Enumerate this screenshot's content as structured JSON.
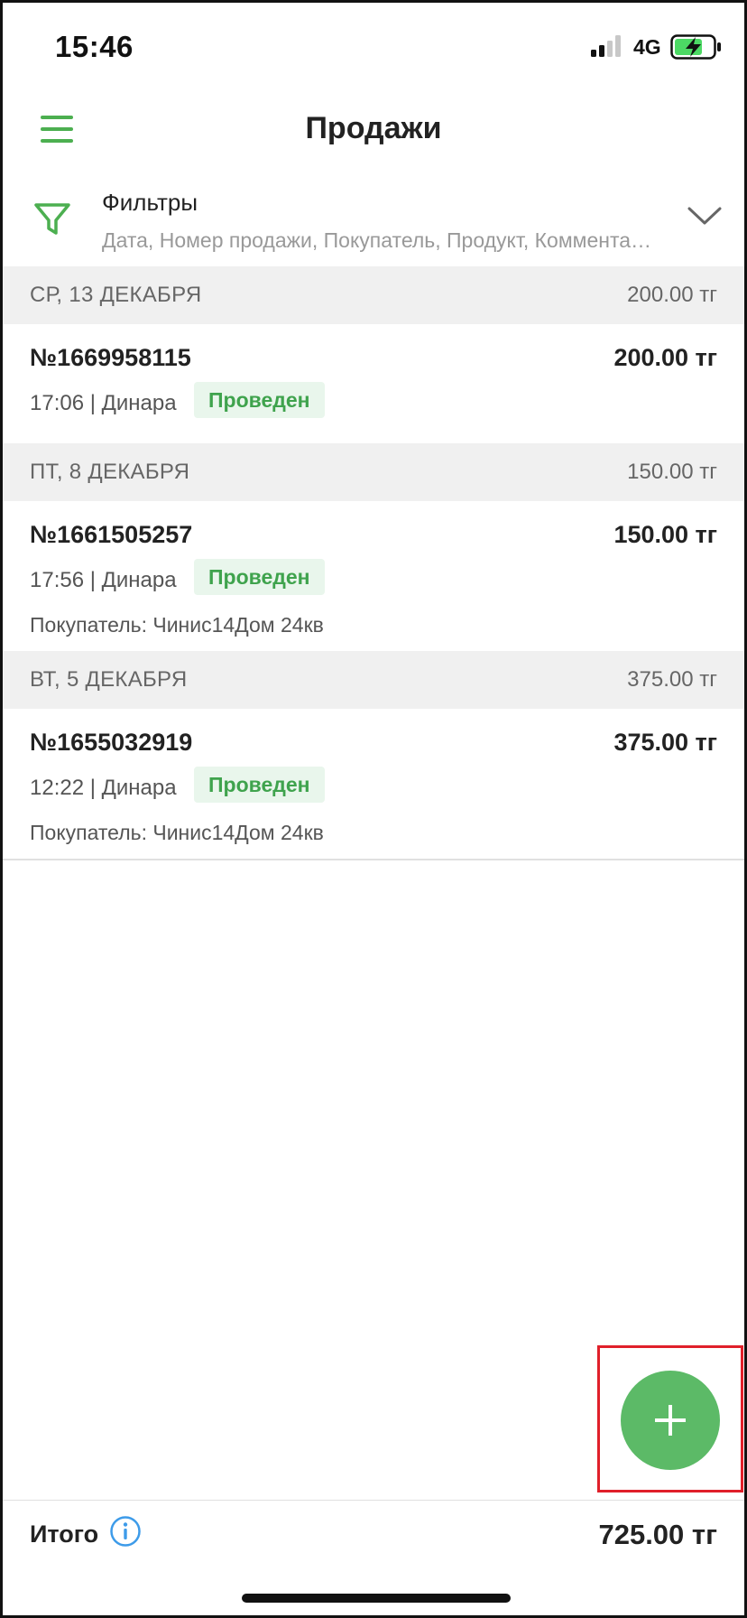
{
  "status_bar": {
    "time": "15:46",
    "network": "4G"
  },
  "header": {
    "title": "Продажи"
  },
  "filters": {
    "title": "Фильтры",
    "subtitle": "Дата, Номер продажи, Покупатель, Продукт, Комментарий"
  },
  "days": [
    {
      "date": "СР, 13 ДЕКАБРЯ",
      "sum": "200.00 тг",
      "sales": [
        {
          "number": "№1669958115",
          "amount": "200.00 тг",
          "meta": "17:06 | Динара",
          "status": "Проведен",
          "buyer": ""
        }
      ]
    },
    {
      "date": "ПТ, 8 ДЕКАБРЯ",
      "sum": "150.00 тг",
      "sales": [
        {
          "number": "№1661505257",
          "amount": "150.00 тг",
          "meta": "17:56 | Динара",
          "status": "Проведен",
          "buyer": "Покупатель: Чинис14Дом 24кв"
        }
      ]
    },
    {
      "date": "ВТ, 5 ДЕКАБРЯ",
      "sum": "375.00 тг",
      "sales": [
        {
          "number": "№1655032919",
          "amount": "375.00 тг",
          "meta": "12:22 | Динара",
          "status": "Проведен",
          "buyer": "Покупатель: Чинис14Дом 24кв"
        }
      ]
    }
  ],
  "footer": {
    "total_label": "Итого",
    "total_value": "725.00 тг"
  },
  "colors": {
    "accent": "#4caf50",
    "fab": "#5cba67",
    "badge_text": "#3fa34d",
    "badge_bg": "#e9f6ec",
    "highlight": "#e0202a",
    "info": "#3d9be9"
  },
  "icons": {
    "menu": "hamburger-icon",
    "filter": "funnel-icon",
    "expand": "chevron-down-icon",
    "add": "plus-icon",
    "info": "info-icon"
  }
}
